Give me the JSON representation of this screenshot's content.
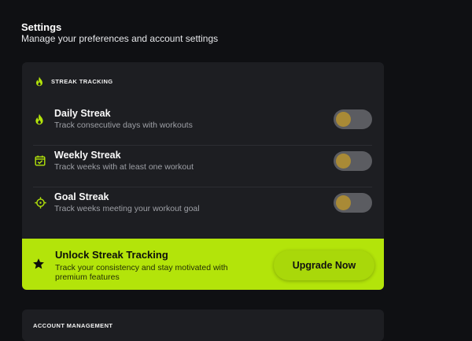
{
  "page": {
    "title": "Settings",
    "subtitle": "Manage your preferences and account settings"
  },
  "streak_section": {
    "title": "STREAK TRACKING",
    "icon": "flame-icon",
    "accent": "#b3e40a",
    "rows": [
      {
        "icon": "flame-icon",
        "label": "Daily Streak",
        "description": "Track consecutive days with workouts",
        "enabled": false
      },
      {
        "icon": "calendar-check-icon",
        "label": "Weekly Streak",
        "description": "Track weeks with at least one workout",
        "enabled": false
      },
      {
        "icon": "target-icon",
        "label": "Goal Streak",
        "description": "Track weeks meeting your workout goal",
        "enabled": false
      }
    ]
  },
  "upgrade_banner": {
    "icon": "star-icon",
    "title": "Unlock Streak Tracking",
    "description": "Track your consistency and stay motivated with premium features",
    "button_label": "Upgrade Now",
    "background": "#b3e40a"
  },
  "account_section": {
    "title": "ACCOUNT MANAGEMENT"
  }
}
